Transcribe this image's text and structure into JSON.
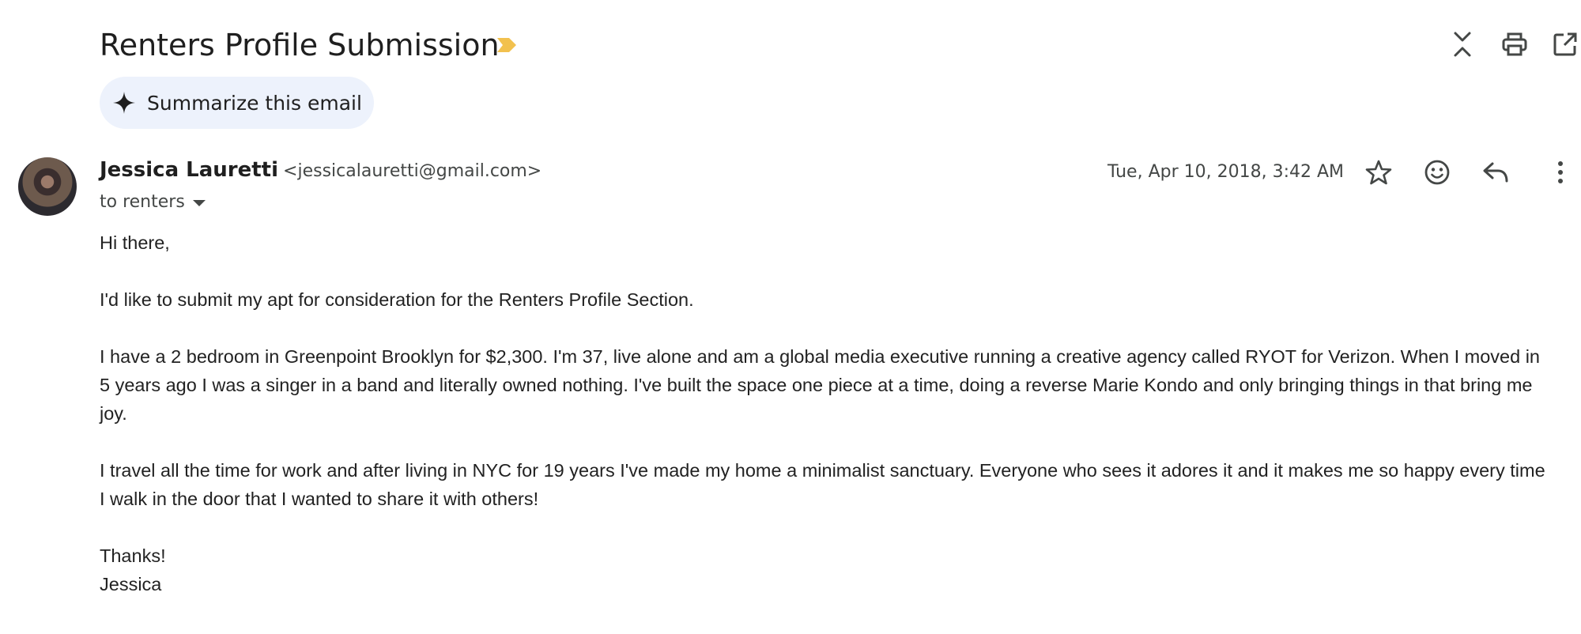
{
  "email": {
    "subject": "Renters Profile Submission",
    "summarize_label": "Summarize this email",
    "sender": {
      "name": "Jessica Lauretti",
      "email": "<jessicalauretti@gmail.com>"
    },
    "recipients_label": "to renters",
    "date": "Tue, Apr 10, 2018, 3:42 AM",
    "body": {
      "greeting": "Hi there,",
      "paragraphs": [
        "I'd like to submit my apt for consideration for the Renters Profile Section.",
        "I have a 2 bedroom in Greenpoint Brooklyn for $2,300.  I'm 37, live alone and am a global media executive running a creative agency called RYOT for Verizon.  When I moved in 5 years ago I was a singer in a band and literally owned nothing.  I've built the space one piece at a time, doing a reverse Marie Kondo and only bringing things in that bring me joy.",
        "I travel all the time for work and after living in NYC for 19 years I've made my home a minimalist sanctuary.  Everyone who sees it adores it and it makes me so happy every time I walk in the door that I wanted to share it with others!"
      ],
      "closing": "Thanks!",
      "signature": "Jessica"
    }
  },
  "icons": {
    "importance": "importance-marker-icon",
    "collapse": "collapse-all-icon",
    "print": "print-icon",
    "open_new": "open-in-new-window-icon",
    "sparkle": "sparkle-icon",
    "star": "star-icon",
    "emoji": "emoji-reaction-icon",
    "reply": "reply-icon",
    "more": "more-options-icon"
  },
  "colors": {
    "importance": "#f2c14e",
    "summarize_bg": "#edf2fc",
    "text_primary": "#1f1f1f",
    "text_secondary": "#444746"
  }
}
